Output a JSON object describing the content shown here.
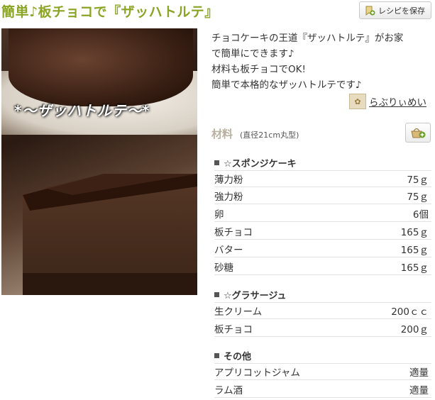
{
  "recipe": {
    "title": "簡単♪板チョコで『ザッハトルテ』",
    "save_label": "レシピを保存",
    "photo_caption": "*～ザッハトルテ～*",
    "description": [
      "チョコケーキの王道『ザッハトルテ』がお家",
      "で簡単にできます♪",
      "材料も板チョコでOK!",
      "簡単で本格的なザッハトルテです♪"
    ],
    "author": "らぶりぃめい"
  },
  "ingredients": {
    "heading": "材料",
    "serving": "(直径21cm丸型)",
    "sections": [
      {
        "title": "☆スポンジケーキ",
        "items": [
          {
            "name": "薄力粉",
            "qty": "75ｇ"
          },
          {
            "name": "強力粉",
            "qty": "75ｇ"
          },
          {
            "name": "卵",
            "qty": "6個"
          },
          {
            "name": "板チョコ",
            "qty": "165ｇ"
          },
          {
            "name": "バター",
            "qty": "165ｇ"
          },
          {
            "name": "砂糖",
            "qty": "165ｇ"
          }
        ]
      },
      {
        "title": "☆グラサージュ",
        "items": [
          {
            "name": "生クリーム",
            "qty": "200ｃｃ"
          },
          {
            "name": "板チョコ",
            "qty": "200ｇ"
          }
        ]
      },
      {
        "title": "その他",
        "items": [
          {
            "name": "アプリコットジャム",
            "qty": "適量"
          },
          {
            "name": "ラム酒",
            "qty": "適量"
          }
        ]
      }
    ]
  },
  "colors": {
    "title": "#8aa523",
    "chocolate": "#3a2014"
  },
  "icons": {
    "save": "bookmark-add-icon",
    "cart": "basket-add-icon",
    "author": "avatar-icon"
  }
}
